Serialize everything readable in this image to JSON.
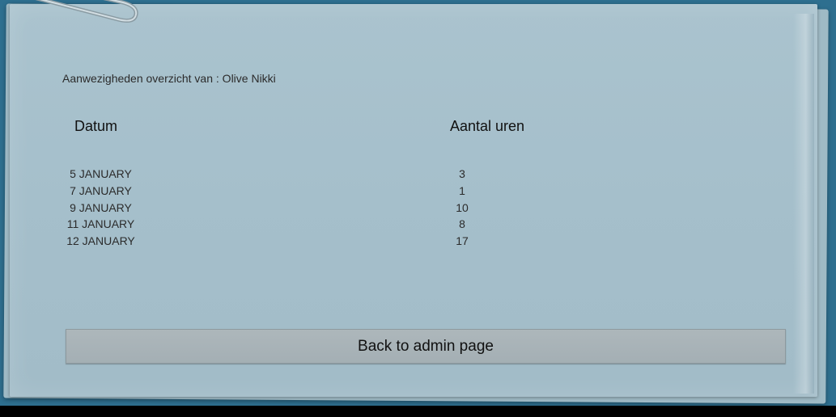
{
  "header": {
    "title": "Aanwezigheden overzicht van : Olive Nikki"
  },
  "table": {
    "columns": [
      "Datum",
      "Aantal uren"
    ],
    "rows": [
      {
        "date": "5 JANUARY",
        "hours": "3"
      },
      {
        "date": "7 JANUARY",
        "hours": "1"
      },
      {
        "date": "9 JANUARY",
        "hours": "10"
      },
      {
        "date": "11 JANUARY",
        "hours": "8"
      },
      {
        "date": "12 JANUARY",
        "hours": "17"
      }
    ]
  },
  "actions": {
    "back_label": "Back to admin page"
  },
  "colors": {
    "background": "#2e6f8f",
    "paper": "#a5bfcb",
    "button": "#a8b2b7"
  },
  "decorations": {
    "clip_icon": "paperclip-icon"
  }
}
